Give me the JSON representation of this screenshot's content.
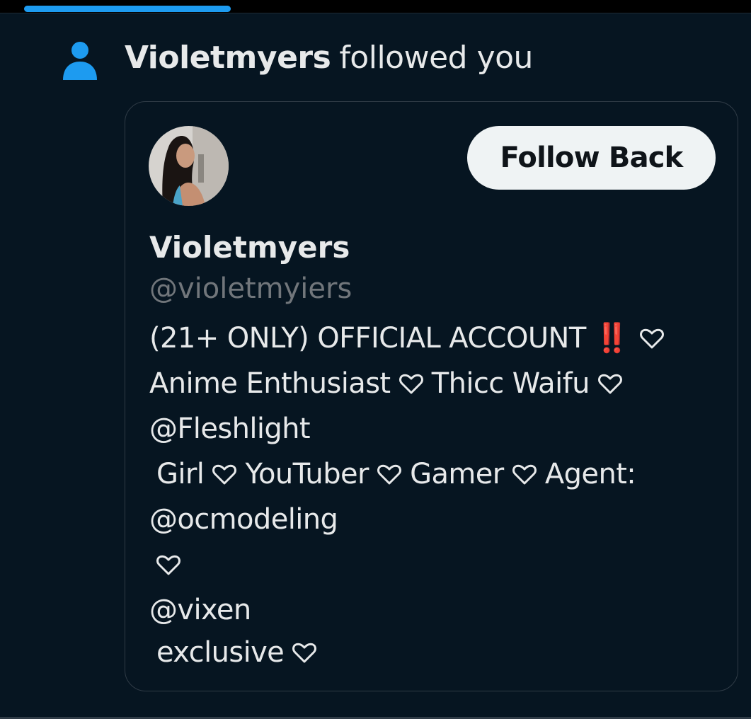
{
  "notification": {
    "icon": "person-icon",
    "actor_name": "Violetmyers",
    "action_text": "followed you"
  },
  "card": {
    "avatar": "profile-avatar",
    "follow_button_label": "Follow Back",
    "display_name": "Violetmyers",
    "handle": "@violetmyiers",
    "bio": {
      "line1_text": "(21+ ONLY) OFFICIAL ACCOUNT",
      "line1_emoji": "‼️",
      "line2_a": "Anime Enthusiast",
      "line2_b": "Thicc Waifu",
      "line3_mention": "@Fleshlight",
      "line4_a": "Girl",
      "line4_b": "YouTuber",
      "line4_c": "Gamer",
      "line4_d": "Agent:",
      "line5_mention": "@ocmodeling",
      "line7_mention": "@vixen",
      "line8_text": "exclusive"
    }
  },
  "colors": {
    "background": "#061521",
    "accent": "#1d9bf0",
    "text_primary": "#e7e9ea",
    "text_secondary": "#71767b",
    "button_bg": "#eff3f4"
  }
}
